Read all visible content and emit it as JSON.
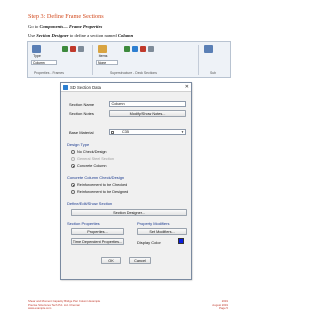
{
  "step_title": "Step 3: Define Frame Sections",
  "instructions": {
    "line1_prefix": "Go to ",
    "line1_bold": "Components— Frame Properties",
    "line2_prefix": "Use ",
    "line2_bold1": "Section Designer",
    "line2_middle": " to define a section named ",
    "line2_bold2": "Column"
  },
  "ribbon": {
    "type_label": "Type",
    "items_label": "Items",
    "column_combo": "Column",
    "none_combo": "None",
    "group_properties": "Properties - Frames",
    "group_superstructure": "Superstructure - Deck Sections",
    "group_sub": "Sub"
  },
  "dialog": {
    "title": "SD Section Data",
    "close_glyph": "✕",
    "section_name_label": "Section Name",
    "section_name_value": "Column",
    "section_notes_label": "Section Notes",
    "modify_notes_button": "Modify/Show Notes...",
    "base_material_label": "Base Material",
    "base_material_value": "C35",
    "design_type_header": "Design Type",
    "design_type_options": [
      "No Check/Design",
      "General Steel Section",
      "Concrete Column"
    ],
    "concrete_header": "Concrete Column Check/Design",
    "concrete_options": [
      "Reinforcement to be Checked",
      "Reinforcement to be Designed"
    ],
    "define_header": "Define/Edit/Show Section",
    "section_designer_button": "Section Designer...",
    "section_properties_header": "Section Properties",
    "property_modifiers_header": "Property Modifiers",
    "properties_button": "Properties...",
    "set_modifiers_button": "Set Modifiers...",
    "time_dependent_button": "Time Dependent Properties...",
    "display_color_label": "Display Color",
    "display_color": "#0a1ee0",
    "ok_button": "OK",
    "cancel_button": "Cancel"
  },
  "footer": {
    "left_line1": "Shear and Moment Capacity Bridge Pier Column Example",
    "left_line2": "Precise Structures Tech Pvt. Ltd. Chennai",
    "left_line3": "www.example.com",
    "right_line1": "2019",
    "right_line2": "August 2019",
    "right_line3": "Page 5"
  }
}
